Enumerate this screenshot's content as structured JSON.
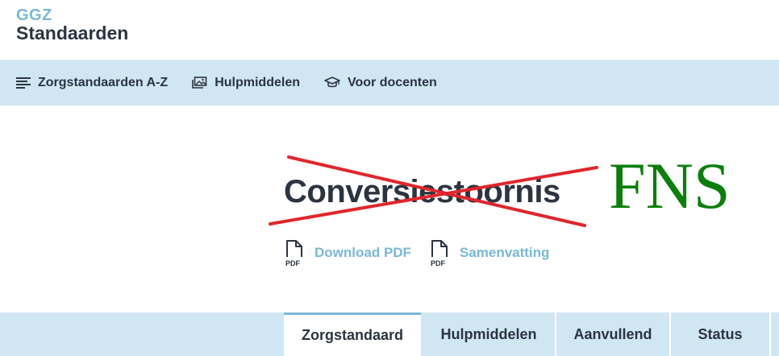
{
  "logo": {
    "line1": "GGZ",
    "line2": "Standaarden"
  },
  "nav": {
    "items": [
      {
        "label": "Zorgstandaarden A-Z",
        "icon": "list-icon"
      },
      {
        "label": "Hulpmiddelen",
        "icon": "images-icon"
      },
      {
        "label": "Voor docenten",
        "icon": "graduation-cap-icon"
      }
    ]
  },
  "page": {
    "title": "Conversiestoornis",
    "annotation": "FNS"
  },
  "downloads": [
    {
      "label": "Download PDF",
      "icon": "pdf-file-icon",
      "icon_text": "PDF"
    },
    {
      "label": "Samenvatting",
      "icon": "pdf-file-icon",
      "icon_text": "PDF"
    }
  ],
  "tabs": [
    {
      "label": "Zorgstandaard",
      "active": true
    },
    {
      "label": "Hulpmiddelen",
      "active": false
    },
    {
      "label": "Aanvullend",
      "active": false
    },
    {
      "label": "Status",
      "active": false
    }
  ],
  "colors": {
    "accent": "#7ab8d6",
    "nav_bg": "#d0e7f3",
    "text_dark": "#2b3440",
    "strike_red": "#e0262d",
    "annotation_green": "#0a7f0a"
  }
}
